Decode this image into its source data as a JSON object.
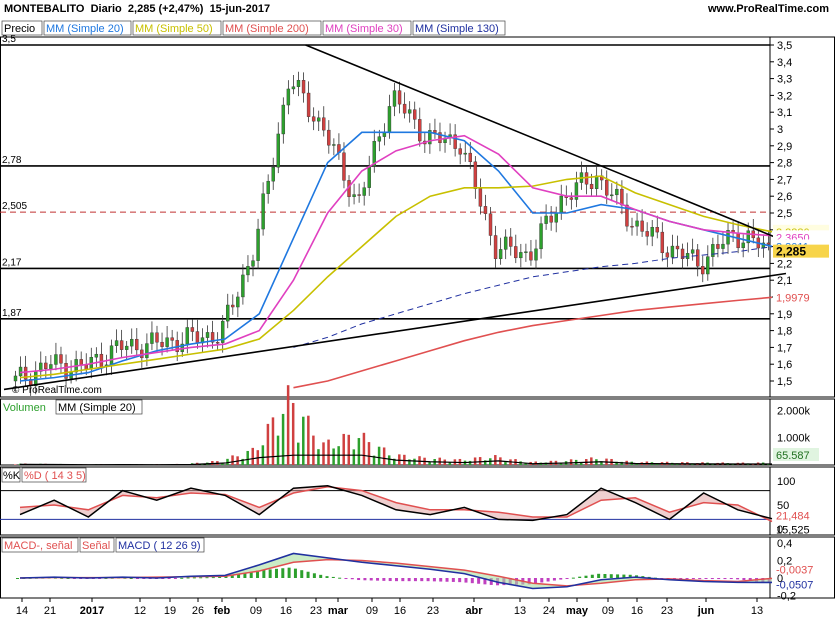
{
  "header": {
    "title": "MONTEBALITO",
    "period": "Diario",
    "price": "2,285 (+2,47%)",
    "date": "15-jun-2017",
    "url": "www.ProRealTime.com"
  },
  "watermark": "© ProRealTime.com",
  "price_panel": {
    "legend": [
      "Precio",
      "MM (Simple 20)",
      "MM (Simple 50)",
      "MM (Simple 200)",
      "MM (Simple 30)",
      "MM (Simple 130)"
    ],
    "y_ticks": [
      "3,5",
      "3,4",
      "3,3",
      "3,2",
      "3,1",
      "3",
      "2,9",
      "2,8",
      "2,7",
      "2,6",
      "2,5",
      "2,4",
      "2,3",
      "2,2",
      "2,1",
      "2",
      "1,9",
      "1,8",
      "1,7",
      "1,6",
      "1,5"
    ],
    "level_labels": [
      "3,5",
      "2,78",
      "2,505",
      "2,17",
      "1,87"
    ],
    "value_labels": {
      "mm50": "2,3880",
      "mm30": "2,3650",
      "mm20": "2,3011",
      "price": "2,285",
      "mm200": "1,9979"
    }
  },
  "volume_panel": {
    "legend": [
      "Volumen",
      "MM (Simple 20)"
    ],
    "y_ticks": [
      "2.000k",
      "1.000k"
    ],
    "value_label": "65.587"
  },
  "stoch_panel": {
    "legend": [
      "%K",
      "%D ( 14 3 5)"
    ],
    "y_ticks": [
      "100",
      "50",
      "0"
    ],
    "value_labels": [
      "21,484",
      "15,525"
    ]
  },
  "macd_panel": {
    "legend": [
      "MACD-, señal",
      "Señal",
      "MACD ( 12 26 9)"
    ],
    "y_ticks": [
      "0,4",
      "0,2",
      "0",
      "-0,2",
      "-0,4"
    ],
    "value_labels": [
      "-0,0037",
      "-0,0507"
    ]
  },
  "x_axis": {
    "labels": [
      "14",
      "21",
      "2017",
      "12",
      "19",
      "26",
      "feb",
      "09",
      "16",
      "23",
      "mar",
      "09",
      "16",
      "23",
      "abr",
      "13",
      "24",
      "may",
      "09",
      "16",
      "23",
      "jun",
      "13"
    ]
  },
  "colors": {
    "candle_up": "#2da02d",
    "candle_down": "#d04040",
    "mm20": "#1f78e0",
    "mm50": "#c8c000",
    "mm200": "#e05050",
    "mm30": "#e040c0",
    "mm130": "#2030a0",
    "trend": "#000000",
    "resist_dashed": "#c03030"
  },
  "chart_data": [
    {
      "type": "line",
      "title": "MONTEBALITO Diario",
      "x": [
        "14",
        "21",
        "2017",
        "12",
        "19",
        "26",
        "feb",
        "09",
        "16",
        "23",
        "mar",
        "09",
        "16",
        "23",
        "abr",
        "13",
        "24",
        "may",
        "09",
        "16",
        "23",
        "jun",
        "13"
      ],
      "ylim": [
        1.45,
        3.55
      ],
      "grid": false,
      "series": [
        {
          "name": "Precio",
          "values": [
            1.5,
            1.6,
            1.58,
            1.7,
            1.72,
            1.75,
            1.78,
            2.3,
            3.3,
            3.0,
            2.55,
            3.2,
            2.95,
            2.92,
            2.3,
            2.25,
            2.6,
            2.72,
            2.45,
            2.3,
            2.2,
            2.38,
            2.285
          ]
        },
        {
          "name": "MM (Simple 20)",
          "values": [
            1.5,
            1.52,
            1.55,
            1.62,
            1.68,
            1.72,
            1.75,
            1.9,
            2.35,
            2.8,
            2.98,
            2.98,
            2.98,
            2.93,
            2.75,
            2.5,
            2.5,
            2.55,
            2.52,
            2.45,
            2.4,
            2.35,
            2.3011
          ]
        },
        {
          "name": "MM (Simple 50)",
          "values": [
            1.52,
            1.54,
            1.57,
            1.6,
            1.63,
            1.66,
            1.69,
            1.75,
            1.92,
            2.12,
            2.3,
            2.48,
            2.6,
            2.65,
            2.65,
            2.66,
            2.7,
            2.72,
            2.62,
            2.55,
            2.48,
            2.43,
            2.388
          ]
        },
        {
          "name": "MM (Simple 200)",
          "values": [
            null,
            null,
            null,
            null,
            null,
            null,
            null,
            null,
            1.46,
            1.5,
            1.56,
            1.62,
            1.68,
            1.74,
            1.79,
            1.83,
            1.86,
            1.89,
            1.92,
            1.94,
            1.96,
            1.98,
            1.9979
          ]
        },
        {
          "name": "MM (Simple 30)",
          "values": [
            1.55,
            1.57,
            1.6,
            1.64,
            1.67,
            1.7,
            1.72,
            1.8,
            2.1,
            2.5,
            2.75,
            2.87,
            2.93,
            2.96,
            2.85,
            2.65,
            2.6,
            2.6,
            2.52,
            2.45,
            2.4,
            2.38,
            2.365
          ]
        },
        {
          "name": "MM (Simple 130)",
          "values": [
            null,
            null,
            null,
            null,
            null,
            null,
            null,
            null,
            1.7,
            1.76,
            1.84,
            1.9,
            1.96,
            2.02,
            2.07,
            2.12,
            2.15,
            2.18,
            2.2,
            2.23,
            2.25,
            2.27,
            2.2997
          ]
        }
      ],
      "levels": [
        3.5,
        2.78,
        2.505,
        2.17,
        1.87
      ]
    },
    {
      "type": "bar",
      "title": "Volumen",
      "ylim": [
        0,
        2200000
      ],
      "series": [
        {
          "name": "Volumen",
          "values": [
            40000,
            30000,
            20000,
            25000,
            20000,
            30000,
            120000,
            450000,
            2000000,
            600000,
            900000,
            300000,
            200000,
            150000,
            250000,
            80000,
            120000,
            200000,
            90000,
            80000,
            70000,
            60000,
            65587
          ]
        }
      ]
    },
    {
      "type": "line",
      "title": "%K %D ( 14 3 5)",
      "ylim": [
        0,
        100
      ],
      "series": [
        {
          "name": "%K",
          "values": [
            30,
            60,
            25,
            80,
            60,
            85,
            70,
            30,
            85,
            90,
            70,
            40,
            30,
            45,
            20,
            18,
            30,
            85,
            55,
            20,
            75,
            40,
            21.484
          ]
        },
        {
          "name": "%D ( 14 3 5)",
          "values": [
            45,
            50,
            40,
            70,
            65,
            75,
            72,
            45,
            75,
            88,
            80,
            55,
            40,
            40,
            35,
            25,
            25,
            60,
            65,
            35,
            55,
            50,
            15.525
          ]
        }
      ]
    },
    {
      "type": "line",
      "title": "MACD ( 12 26 9)",
      "ylim": [
        -0.45,
        0.45
      ],
      "series": [
        {
          "name": "MACD",
          "values": [
            0,
            0.01,
            0,
            0.01,
            0,
            0.02,
            0.03,
            0.15,
            0.28,
            0.23,
            0.18,
            0.14,
            0.1,
            0.05,
            -0.05,
            -0.12,
            -0.1,
            -0.02,
            0.01,
            -0.02,
            -0.04,
            -0.05,
            -0.0507
          ]
        },
        {
          "name": "Señal",
          "values": [
            0,
            0.005,
            0.005,
            0.005,
            0.01,
            0.015,
            0.02,
            0.08,
            0.18,
            0.21,
            0.2,
            0.17,
            0.13,
            0.09,
            0.02,
            -0.06,
            -0.09,
            -0.06,
            -0.02,
            -0.01,
            -0.03,
            -0.04,
            -0.0037
          ]
        }
      ]
    }
  ]
}
